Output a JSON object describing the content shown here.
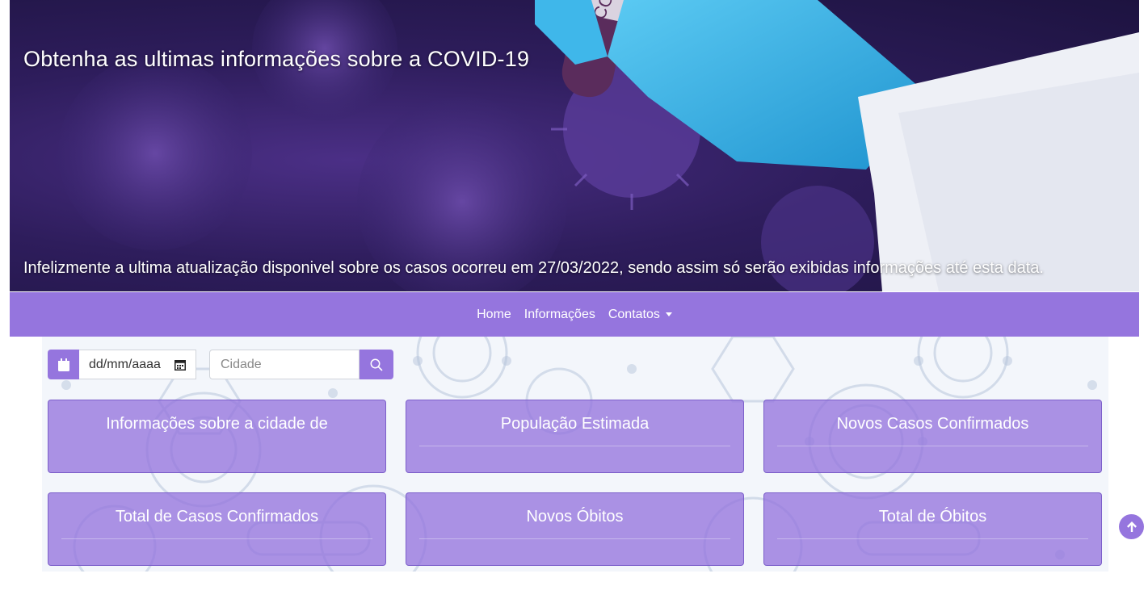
{
  "hero": {
    "title": "Obtenha as ultimas informações sobre a COVID-19",
    "note": "Infelizmente a ultima atualização disponivel sobre os casos ocorreu em 27/03/2022, sendo assim só serão exibidas informações até esta data.",
    "tube_label": "COVI"
  },
  "nav": {
    "home": "Home",
    "info": "Informações",
    "contacts": "Contatos"
  },
  "search": {
    "calendar_icon": "calendar-icon",
    "date_placeholder": "dd/mm/aaaa",
    "city_placeholder": "Cidade",
    "search_icon": "search-icon"
  },
  "cards": [
    {
      "title": "Informações sobre a cidade de"
    },
    {
      "title": "População Estimada"
    },
    {
      "title": "Novos Casos Confirmados"
    },
    {
      "title": "Total de Casos Confirmados"
    },
    {
      "title": "Novos Óbitos"
    },
    {
      "title": "Total de Óbitos"
    }
  ],
  "back_to_top_icon": "arrow-up-icon",
  "colors": {
    "accent": "#9575de",
    "hero_bg": "#2e1d5c",
    "glove": "#37b5e8"
  }
}
